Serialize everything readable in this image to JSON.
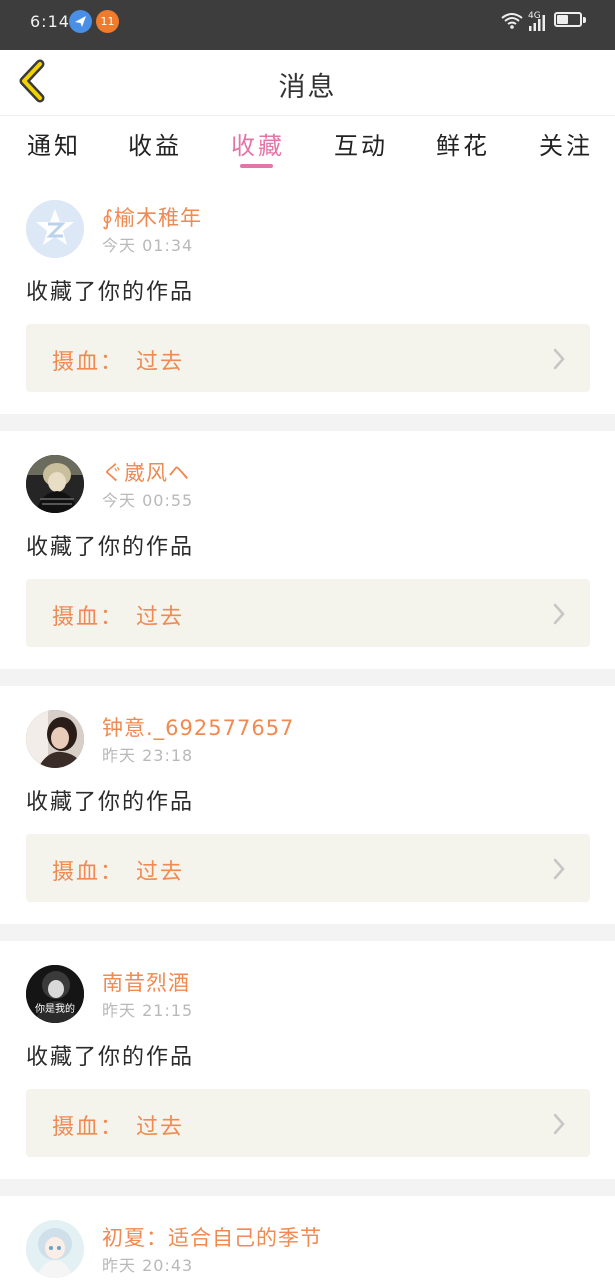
{
  "status_bar": {
    "time": "6:14",
    "notification_count": "11",
    "network": "4G"
  },
  "header": {
    "title": "消息"
  },
  "tabs": [
    {
      "label": "通知",
      "active": false
    },
    {
      "label": "收益",
      "active": false
    },
    {
      "label": "收藏",
      "active": true
    },
    {
      "label": "互动",
      "active": false
    },
    {
      "label": "鲜花",
      "active": false
    },
    {
      "label": "关注",
      "active": false
    }
  ],
  "messages": [
    {
      "username": "∮榆木稚年",
      "time": "今天 01:34",
      "action": "收藏了你的作品",
      "work_prefix": "摄血：",
      "work_title": "过去"
    },
    {
      "username": "ぐ崴风ヘ",
      "time": "今天 00:55",
      "action": "收藏了你的作品",
      "work_prefix": "摄血：",
      "work_title": "过去"
    },
    {
      "username": "钟意._692577657",
      "time": "昨天 23:18",
      "action": "收藏了你的作品",
      "work_prefix": "摄血：",
      "work_title": "过去"
    },
    {
      "username": "南昔烈酒",
      "time": "昨天 21:15",
      "action": "收藏了你的作品",
      "work_prefix": "摄血：",
      "work_title": "过去",
      "avatar_text": "你是我的"
    },
    {
      "username": "初夏：适合自己的季节",
      "time": "昨天 20:43"
    }
  ],
  "colors": {
    "accent_pink": "#e276a8",
    "accent_orange": "#ef8a52",
    "box_bg": "#f4f3ec",
    "status_bar_bg": "#3d3d3d"
  }
}
